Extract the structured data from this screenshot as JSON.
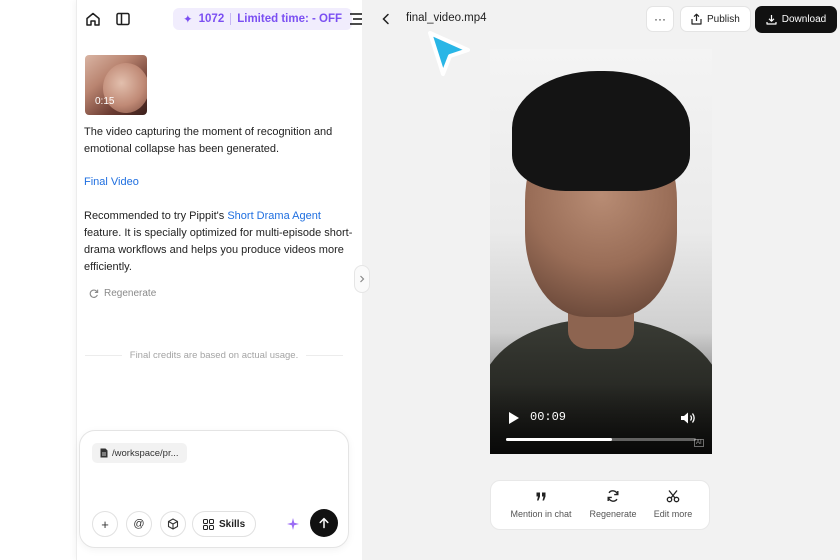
{
  "header": {
    "credits": "1072",
    "promo": "Limited time: - OFF"
  },
  "chat": {
    "thumbnail_duration": "0:15",
    "message_1": "The video capturing the moment of recognition and emotional collapse has been generated.",
    "final_video_link": "Final Video",
    "message_2_prefix": "Recommended to try Pippit's ",
    "message_2_link": "Short Drama Agent",
    "message_2_suffix": " feature. It is specially optimized for multi-episode short-drama workflows and helps you produce videos more efficiently.",
    "regenerate_label": "Regenerate",
    "credits_note": "Final credits are based on actual usage."
  },
  "composer": {
    "file_chip": "/workspace/pr...",
    "plus_label": "+",
    "at_label": "@",
    "skills_label": "Skills"
  },
  "preview": {
    "file_name": "final_video.mp4",
    "more_label": "···",
    "publish_label": "Publish",
    "download_label": "Download",
    "time": "00:09",
    "progress": 0.56,
    "ai_badge": "AI",
    "actions": [
      {
        "label": "Mention in chat",
        "icon": "quote-icon"
      },
      {
        "label": "Regenerate",
        "icon": "refresh-icon"
      },
      {
        "label": "Edit more",
        "icon": "scissors-icon"
      }
    ]
  },
  "colors": {
    "accent": "#7b4ff2",
    "link": "#1f6fe0",
    "cursor": "#29b6e6",
    "download_bg": "#111111"
  }
}
